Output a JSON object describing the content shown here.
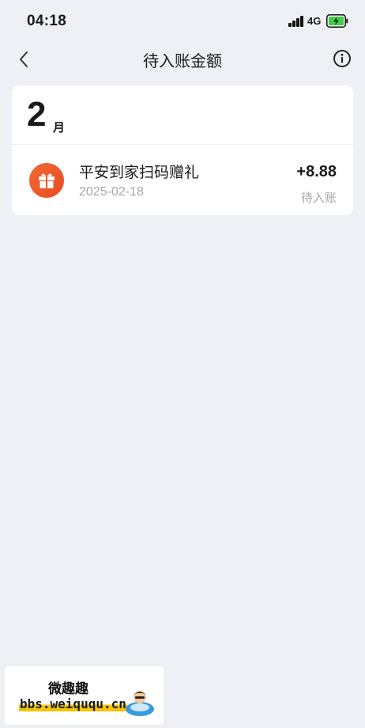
{
  "status_bar": {
    "time": "04:18",
    "network": "4G"
  },
  "header": {
    "title": "待入账金额"
  },
  "month_group": {
    "month_number": "2",
    "month_unit": "月",
    "records": [
      {
        "title": "平安到家扫码赠礼",
        "date": "2025-02-18",
        "amount": "+8.88",
        "status": "待入账",
        "icon": "gift-icon",
        "icon_color": "#f05a2a"
      }
    ]
  },
  "watermark": {
    "title": "微趣趣",
    "url": "bbs.weiququ.cn"
  },
  "colors": {
    "background": "#eff0f5",
    "card": "#ffffff",
    "secondary_text": "#a6a6ad",
    "battery_charge": "#3fcf4a"
  }
}
